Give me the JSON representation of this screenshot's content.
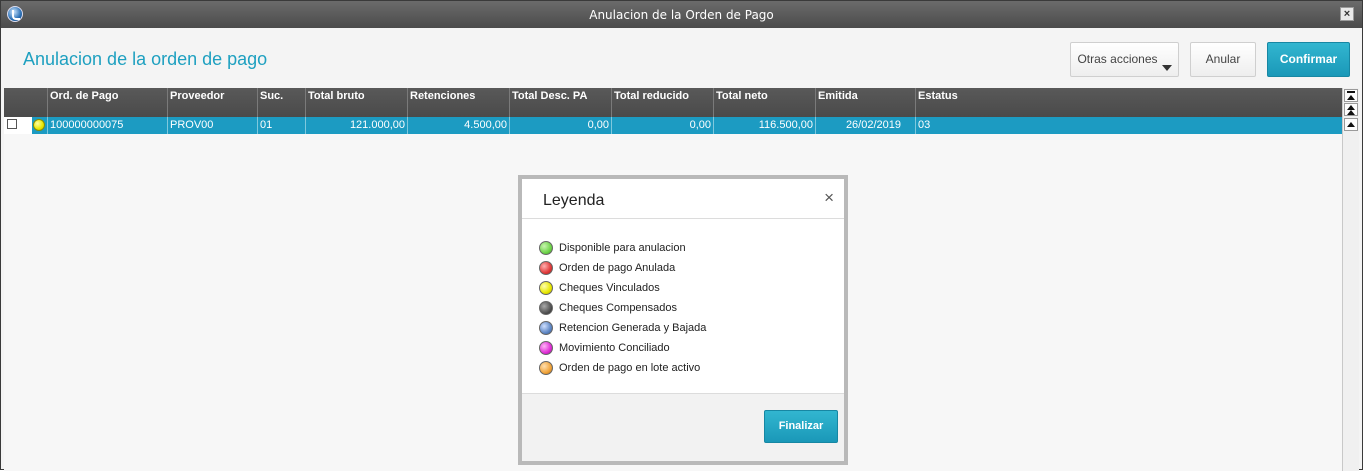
{
  "window": {
    "title": "Anulacion de la Orden de Pago",
    "close_label": "×"
  },
  "page": {
    "title": "Anulacion de la orden de pago"
  },
  "toolbar": {
    "otras_acciones_label": "Otras acciones",
    "anular_label": "Anular",
    "confirmar_label": "Confirmar",
    "accent_color": "#1a9cbc"
  },
  "grid": {
    "columns": [
      "Ord. de Pago",
      "Proveedor",
      "Suc.",
      "Total bruto",
      "Retenciones",
      "Total Desc. PA",
      "Total reducido",
      "Total neto",
      "Emitida",
      "Estatus"
    ],
    "rows": [
      {
        "status_color": "#e7e700",
        "cells": [
          "100000000075",
          "PROV00",
          "01",
          "121.000,00",
          "4.500,00",
          "0,00",
          "0,00",
          "116.500,00",
          "26/02/2019",
          "03"
        ]
      }
    ]
  },
  "legend": {
    "title": "Leyenda",
    "close_label": "×",
    "items": [
      {
        "label": "Disponible para anulacion",
        "color": "#6fd44a"
      },
      {
        "label": "Orden de pago Anulada",
        "color": "#e03a3a"
      },
      {
        "label": "Cheques Vinculados",
        "color": "#e7e700"
      },
      {
        "label": "Cheques Compensados",
        "color": "#555555"
      },
      {
        "label": "Retencion Generada y Bajada",
        "color": "#5f87c4"
      },
      {
        "label": "Movimiento Conciliado",
        "color": "#e02fd6"
      },
      {
        "label": "Orden de pago en lote activo",
        "color": "#f0a33a"
      }
    ],
    "finalizar_label": "Finalizar"
  }
}
